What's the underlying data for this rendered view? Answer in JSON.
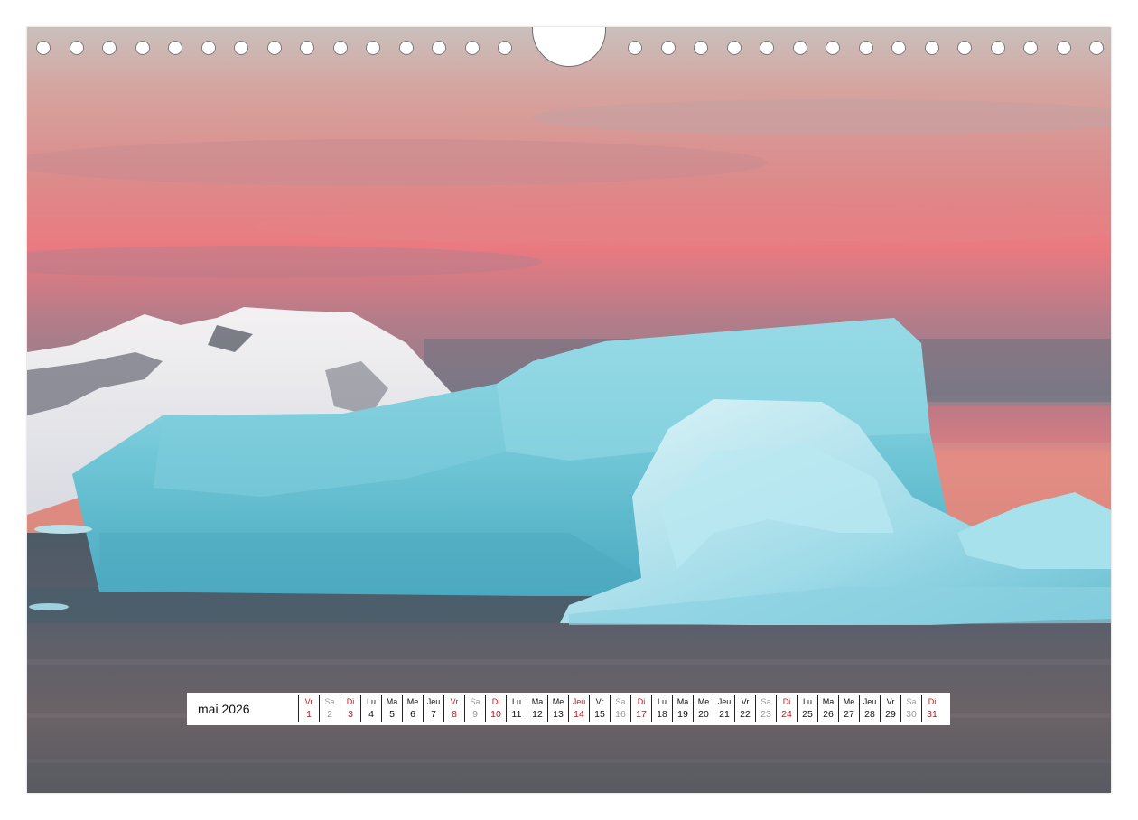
{
  "calendar": {
    "month_label": "mai 2026",
    "days": [
      {
        "name": "Vr",
        "num": "1",
        "type": "hl"
      },
      {
        "name": "Sa",
        "num": "2",
        "type": "sa"
      },
      {
        "name": "Di",
        "num": "3",
        "type": "hl"
      },
      {
        "name": "Lu",
        "num": "4",
        "type": ""
      },
      {
        "name": "Ma",
        "num": "5",
        "type": ""
      },
      {
        "name": "Me",
        "num": "6",
        "type": ""
      },
      {
        "name": "Jeu",
        "num": "7",
        "type": ""
      },
      {
        "name": "Vr",
        "num": "8",
        "type": "hl"
      },
      {
        "name": "Sa",
        "num": "9",
        "type": "sa"
      },
      {
        "name": "Di",
        "num": "10",
        "type": "hl"
      },
      {
        "name": "Lu",
        "num": "11",
        "type": ""
      },
      {
        "name": "Ma",
        "num": "12",
        "type": ""
      },
      {
        "name": "Me",
        "num": "13",
        "type": ""
      },
      {
        "name": "Jeu",
        "num": "14",
        "type": "hl"
      },
      {
        "name": "Vr",
        "num": "15",
        "type": ""
      },
      {
        "name": "Sa",
        "num": "16",
        "type": "sa"
      },
      {
        "name": "Di",
        "num": "17",
        "type": "hl"
      },
      {
        "name": "Lu",
        "num": "18",
        "type": ""
      },
      {
        "name": "Ma",
        "num": "19",
        "type": ""
      },
      {
        "name": "Me",
        "num": "20",
        "type": ""
      },
      {
        "name": "Jeu",
        "num": "21",
        "type": ""
      },
      {
        "name": "Vr",
        "num": "22",
        "type": ""
      },
      {
        "name": "Sa",
        "num": "23",
        "type": "sa"
      },
      {
        "name": "Di",
        "num": "24",
        "type": "hl"
      },
      {
        "name": "Lu",
        "num": "25",
        "type": ""
      },
      {
        "name": "Ma",
        "num": "26",
        "type": ""
      },
      {
        "name": "Me",
        "num": "27",
        "type": ""
      },
      {
        "name": "Jeu",
        "num": "28",
        "type": ""
      },
      {
        "name": "Vr",
        "num": "29",
        "type": ""
      },
      {
        "name": "Sa",
        "num": "30",
        "type": "sa"
      },
      {
        "name": "Di",
        "num": "31",
        "type": "hl"
      }
    ]
  },
  "colors": {
    "holiday_red": "#c4161c",
    "saturday_gray": "#9a9a9a",
    "iceberg_blue": "#6fc6d6",
    "sunset_pink": "#e9797f"
  },
  "binding": {
    "hole_count_left": 15,
    "hole_count_right": 15
  }
}
